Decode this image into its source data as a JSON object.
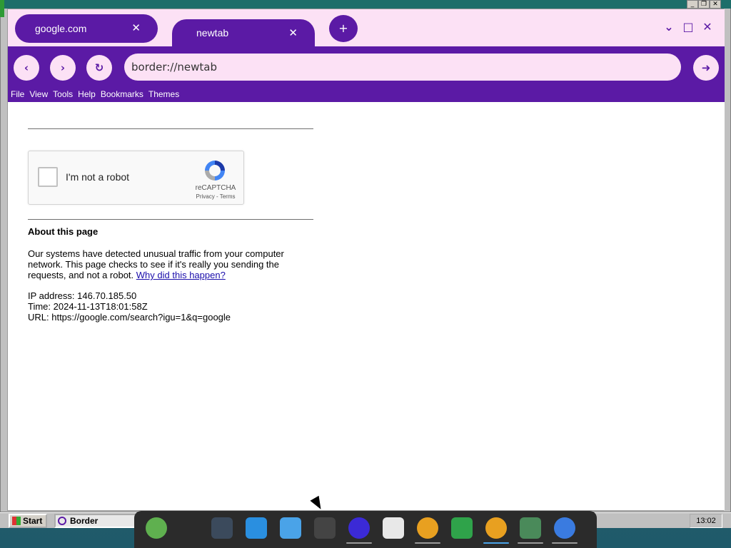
{
  "browser": {
    "tabs": [
      {
        "label": "google.com",
        "close": "✕"
      },
      {
        "label": "newtab",
        "close": "✕"
      }
    ],
    "new_tab": "+",
    "window_controls": [
      "⌄",
      "□",
      "✕"
    ],
    "nav": {
      "back": "‹",
      "forward": "›",
      "reload": "↻",
      "go": "➜"
    },
    "address": "border://newtab",
    "menu": [
      "File",
      "View",
      "Tools",
      "Help",
      "Bookmarks",
      "Themes"
    ],
    "colors": {
      "accent": "#5b1aa5",
      "light": "#fce1f5"
    }
  },
  "page": {
    "captcha": {
      "label": "I'm not a robot",
      "brand": "reCAPTCHA",
      "links": "Privacy - Terms"
    },
    "about_title": "About this page",
    "paragraph": "Our systems have detected unusual traffic from your computer network. This page checks to see if it's really you sending the requests, and not a robot.",
    "why_link": "Why did this happen?",
    "ip": "IP address: 146.70.185.50",
    "time": "Time: 2024-11-13T18:01:58Z",
    "url": "URL: https://google.com/search?igu=1&q=google"
  },
  "taskbar": {
    "start": "Start",
    "task": "Border",
    "clock": "13:02"
  },
  "dock": {
    "items": [
      "mint-menu-icon",
      "settings-icon",
      "store-icon",
      "files-icon",
      "terminal-icon",
      "app-f-icon",
      "text-file-icon",
      "app-w-icon",
      "spreadsheet-icon",
      "app-w2-icon",
      "image-viewer-icon",
      "chrome-icon"
    ]
  }
}
